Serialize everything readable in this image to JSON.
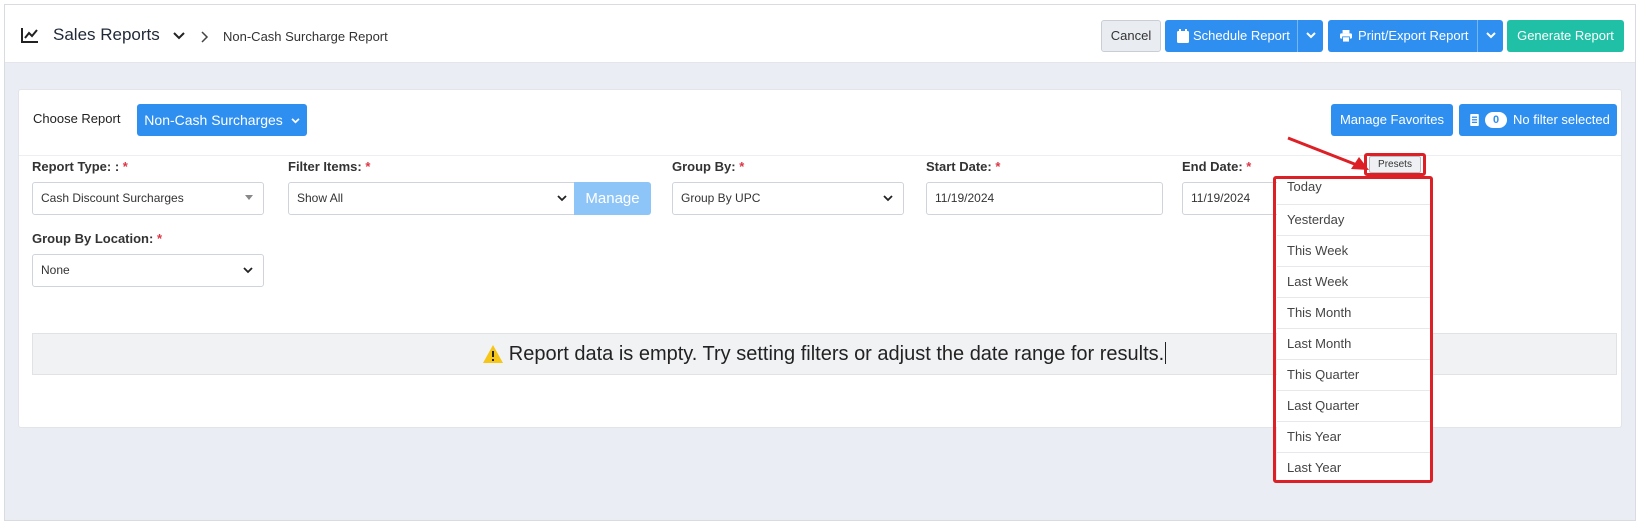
{
  "topbar": {
    "title": "Sales Reports",
    "breadcrumb": "Non-Cash Surcharge Report",
    "cancel_label": "Cancel",
    "schedule_label": "Schedule Report",
    "print_label": "Print/Export Report",
    "generate_label": "Generate Report"
  },
  "report": {
    "choose_label": "Choose Report",
    "selected_report": "Non-Cash Surcharges",
    "manage_favorites_label": "Manage Favorites",
    "filter_count": "0",
    "filter_status": "No filter selected"
  },
  "filters": {
    "report_type_label": "Report Type: :",
    "report_type_value": "Cash Discount Surcharges",
    "filter_items_label": "Filter Items:",
    "filter_items_value": "Show All",
    "manage_label": "Manage",
    "group_by_label": "Group By:",
    "group_by_value": "Group By UPC",
    "start_date_label": "Start Date:",
    "start_date_value": "11/19/2024",
    "end_date_label": "End Date:",
    "end_date_value": "11/19/2024",
    "group_by_location_label": "Group By Location:",
    "group_by_location_value": "None",
    "required_mark": "*"
  },
  "empty_message": "Report data is empty. Try setting filters or adjust the date range for results.",
  "presets": {
    "button_label": "Presets",
    "items": [
      "Today",
      "Yesterday",
      "This Week",
      "Last Week",
      "This Month",
      "Last Month",
      "This Quarter",
      "Last Quarter",
      "This Year",
      "Last Year"
    ]
  },
  "colors": {
    "primary": "#2f8ff0",
    "success": "#20c0a6",
    "highlight": "#dd1f26",
    "warning": "#f5c518"
  },
  "icons": {
    "title": "chart-line-icon",
    "schedule": "calendar-icon",
    "print": "printer-icon",
    "filter": "filter-list-icon",
    "warning": "warning-icon"
  }
}
